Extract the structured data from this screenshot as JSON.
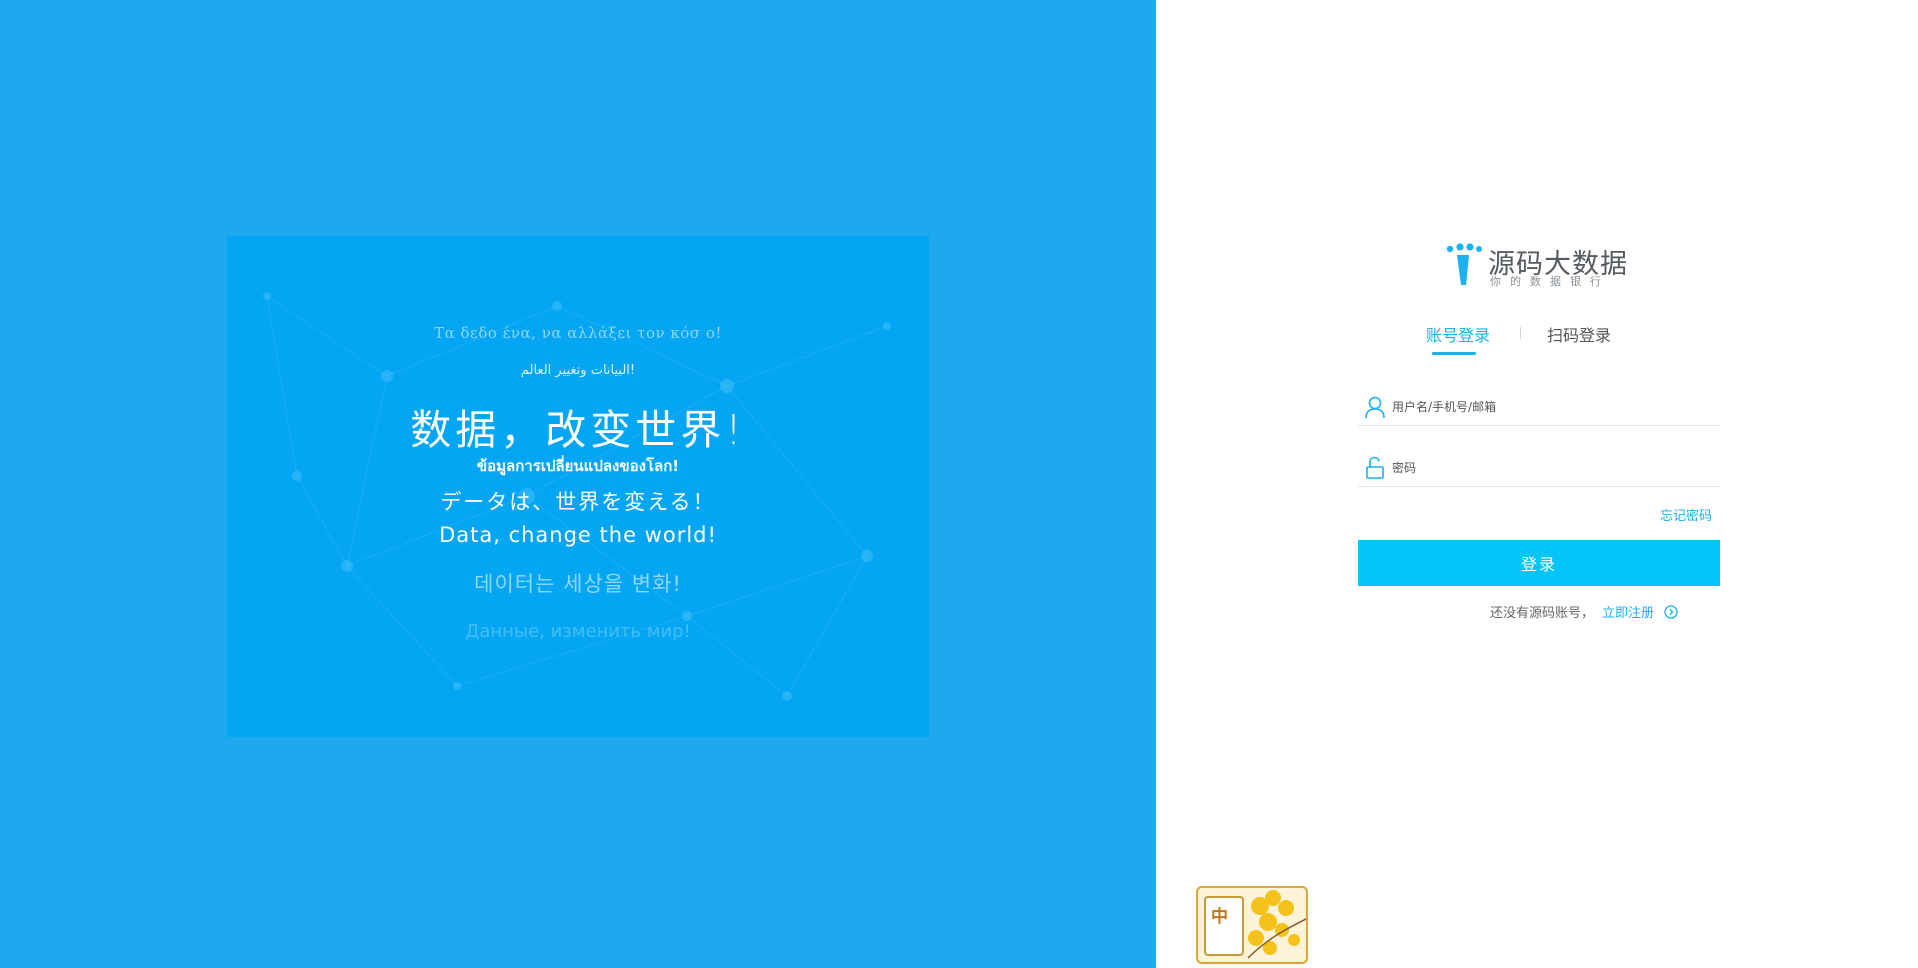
{
  "hero": {
    "greek": "Τα δεδο  ένα, να αλλάξει τον κόσ  ο!",
    "arabic": "البيانات وتغيير العالم!",
    "chinese": "数据，改变世界!",
    "thai": "ข้อมูลการเปลี่ยนแปลงของโลก!",
    "japanese": "データは、世界を変える！",
    "english": "Data, change the world!",
    "korean": "데이터는 세상을 변화!",
    "russian": "Данные, изменить мир!"
  },
  "logo": {
    "title": "源码大数据",
    "subtitle": "你的数据银行",
    "icon": "logo-mark-icon"
  },
  "tabs": [
    {
      "label": "账号登录",
      "active": true
    },
    {
      "label": "扫码登录",
      "active": false
    }
  ],
  "form": {
    "username_placeholder": "用户名/手机号/邮箱",
    "password_placeholder": "密码",
    "username_value": "",
    "password_value": "",
    "forgot_label": "忘记密码",
    "submit_label": "登录",
    "no_account_hint": "还没有源码账号，",
    "register_label": "立即注册"
  },
  "icons": {
    "username": "user-icon",
    "password": "lock-icon",
    "register_arrow": "chevron-right-circle-icon"
  },
  "ime": {
    "char": "中"
  },
  "colors": {
    "left_bg": "#1ea8ee",
    "hero_bg": "#04a6f3",
    "accent": "#1ab2f0",
    "button": "#05c4f7"
  }
}
